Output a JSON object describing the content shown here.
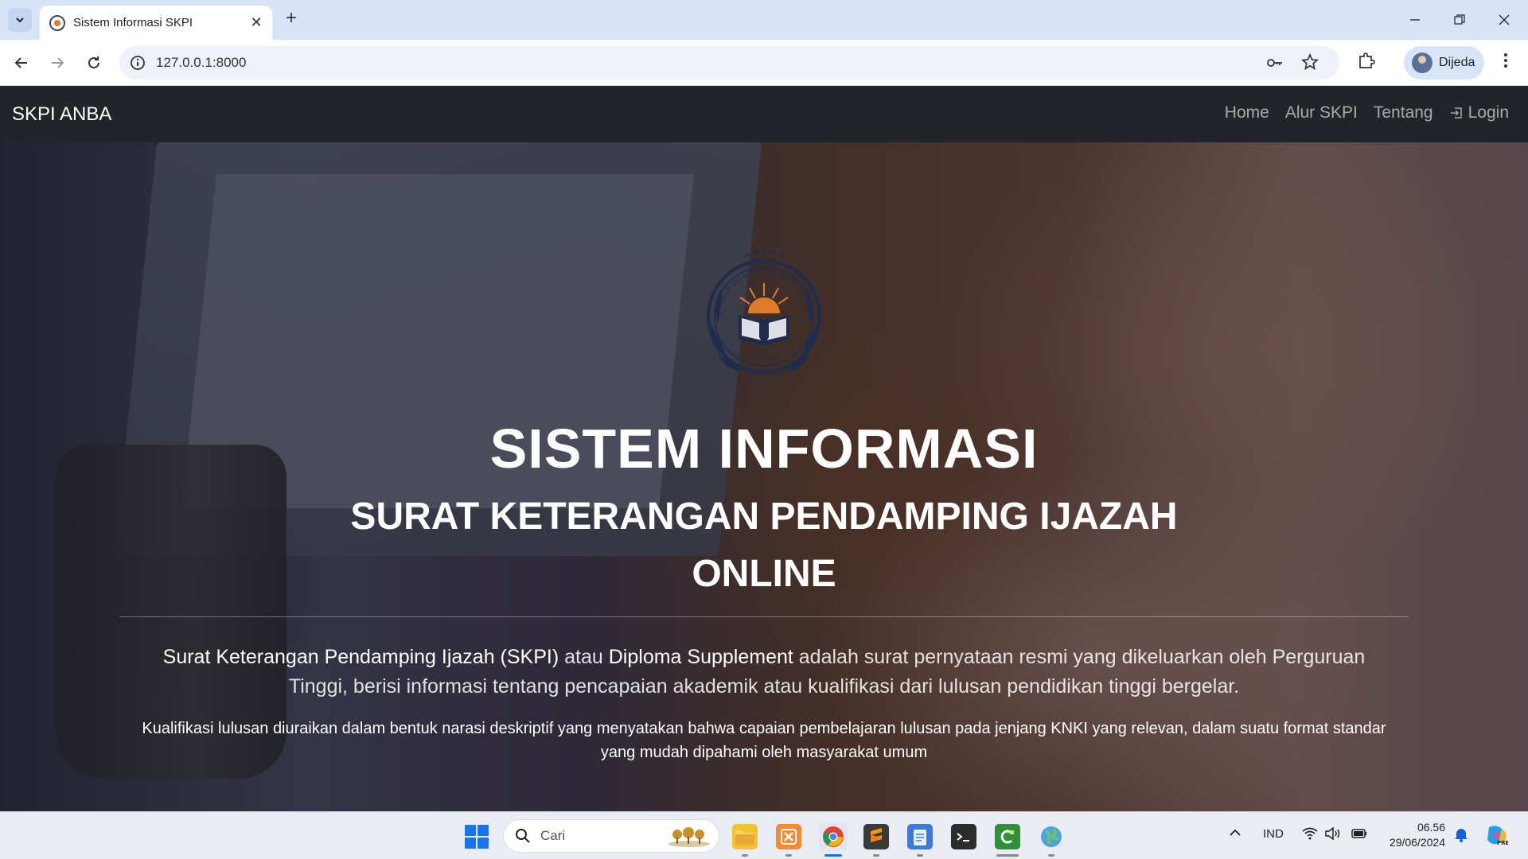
{
  "browser": {
    "tab_title": "Sistem Informasi SKPI",
    "url": "127.0.0.1:8000",
    "profile_name": "Dijeda"
  },
  "site": {
    "brand": "SKPI ANBA",
    "nav": [
      {
        "label": "Home",
        "icon": ""
      },
      {
        "label": "Alur SKPI",
        "icon": ""
      },
      {
        "label": "Tentang",
        "icon": ""
      },
      {
        "label": "Login",
        "icon": "login-icon"
      }
    ]
  },
  "hero": {
    "logo_top_text": "YOUR INSTITUTION NAME HERE",
    "logo_bottom_text": "ESTD. 2000",
    "title": "SISTEM INFORMASI",
    "subtitle": "SURAT KETERANGAN PENDAMPING IJAZAH ONLINE",
    "para1_part1": "Surat Keterangan Pendamping Ijazah (SKPI)",
    "para1_part2": " atau ",
    "para1_part3": "Diploma Supplement",
    "para1_part4": " adalah surat pernyataan resmi yang dikeluarkan oleh Perguruan Tinggi, berisi informasi tentang pencapaian akademik atau kualifikasi dari lulusan pendidikan tinggi bergelar.",
    "para2": "Kualifikasi lulusan diuraikan dalam bentuk narasi deskriptif yang menyatakan bahwa capaian pembelajaran lulusan pada jenjang KNKI yang relevan, dalam suatu format standar yang mudah dipahami oleh masyarakat umum"
  },
  "taskbar": {
    "search_label": "Cari",
    "language": "IND",
    "time": "06.56",
    "date": "29/06/2024",
    "apps": [
      "windows-start",
      "file-explorer",
      "xampp",
      "chrome",
      "sublime-text",
      "notepad",
      "terminal",
      "camtasia",
      "globe-app"
    ]
  },
  "colors": {
    "navbar_bg": "#212529",
    "chrome_accent": "#d7e3f6",
    "hero_text": "#ffffff"
  }
}
